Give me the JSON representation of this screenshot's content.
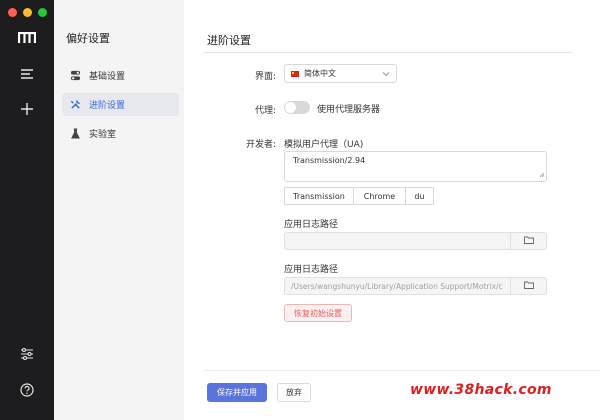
{
  "sidebar": {
    "title": "偏好设置",
    "items": [
      {
        "label": "基础设置",
        "icon": "basic-settings-icon"
      },
      {
        "label": "进阶设置",
        "icon": "tools-icon"
      },
      {
        "label": "实验室",
        "icon": "flask-icon"
      }
    ]
  },
  "main": {
    "title": "进阶设置",
    "language": {
      "label": "界面:",
      "value": "简体中文"
    },
    "proxy": {
      "label": "代理:",
      "toggle_label": "使用代理服务器",
      "enabled": false
    },
    "developer": {
      "label": "开发者:",
      "ua_title": "模拟用户代理（UA)",
      "ua_value": "Transmission/2.94",
      "ua_buttons": [
        "Transmission",
        "Chrome",
        "du"
      ],
      "log_path1": {
        "label": "应用日志路径",
        "value": ""
      },
      "log_path2": {
        "label": "应用日志路径",
        "value": "/Users/wangshunyu/Library/Application Support/Motrix/c"
      },
      "reset_label": "恢复初始设置"
    }
  },
  "footer": {
    "save_label": "保存并应用",
    "discard_label": "放弃"
  },
  "watermark": "www.38hack.com",
  "colors": {
    "accent": "#5a74de",
    "danger": "#e45a5a",
    "rail": "#1d1d1f"
  }
}
